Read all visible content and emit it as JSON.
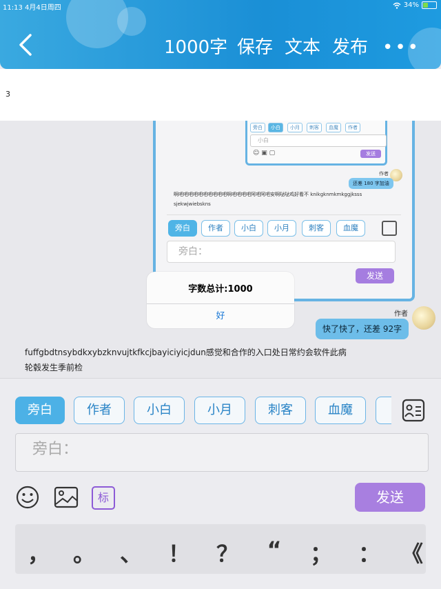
{
  "status_bar": {
    "time": "11:13",
    "date": "4月4日周四",
    "battery": "34%"
  },
  "header": {
    "word_count_btn": "1000字",
    "save_btn": "保存",
    "text_btn": "文本",
    "publish_btn": "发布",
    "more_icon": "more-icon"
  },
  "content": {
    "first_line": "3"
  },
  "inner_screenshot": {
    "mini_tabs": [
      "旁白",
      "作者",
      "小白",
      "小月",
      "刺客",
      "血魔",
      "作者"
    ],
    "mini_input_placeholder": "小白",
    "mini_send": "发送",
    "author_label": "作者",
    "bubble": "还差 180 字加油",
    "para_line1": "啊吧吧吧吧吧吧吧吧吧吧啊吧吧吧吧阿吧阿吧安啊哒哒鸡好看不 knikgknmkmkggjksss",
    "para_line2": "sjekwjwiebskns",
    "tabs": [
      "旁白",
      "作者",
      "小白",
      "小月",
      "刺客",
      "血魔"
    ],
    "input_placeholder": "旁白：",
    "send": "发送"
  },
  "alert": {
    "message": "字数总计:1000",
    "ok": "好"
  },
  "chat": {
    "author_label": "作者",
    "bubble": "快了快了，还差 92字",
    "paragraph_line1": "fuffgbdtnsybdkxybzknvujtkfkcjbayiciyicjdun感觉和合作的入口处日常约会软件此病",
    "paragraph_line2": "轮毂发生季前检"
  },
  "editor": {
    "tabs": [
      "旁白",
      "作者",
      "小白",
      "小月",
      "刺客",
      "血魔"
    ],
    "selected_tab": "旁白",
    "input_placeholder": "旁白：",
    "mark_btn": "标",
    "send": "发送",
    "punctuation": [
      "，",
      "。",
      "、",
      "！",
      "？",
      "“",
      "；",
      "：",
      "《"
    ]
  },
  "colors": {
    "header": "#1a8fd6",
    "accent": "#4cb1e6",
    "send": "#a87fe0"
  }
}
